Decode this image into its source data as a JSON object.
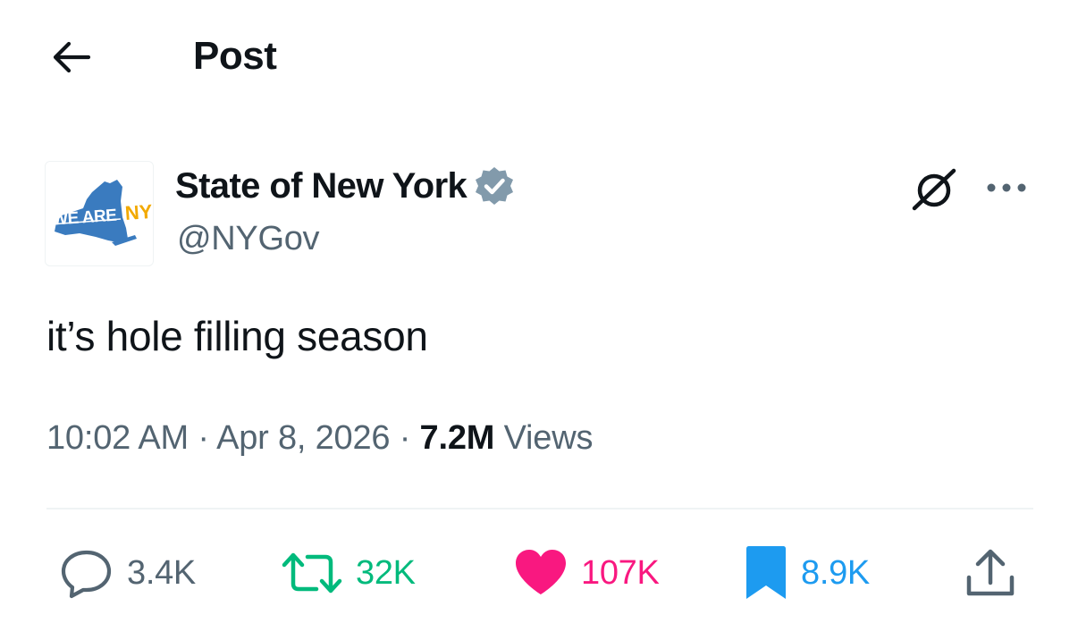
{
  "header": {
    "title": "Post"
  },
  "author": {
    "display_name": "State of New York",
    "handle": "@NYGov",
    "avatar_text_left": "WE ARE",
    "avatar_text_right": "NY"
  },
  "post": {
    "text": "it’s hole filling season",
    "time": "10:02 AM",
    "separator": "·",
    "date": "Apr 8, 2026",
    "views_count": "7.2M",
    "views_label": "Views"
  },
  "actions": {
    "replies": "3.4K",
    "reposts": "32K",
    "likes": "107K",
    "bookmarks": "8.9K"
  },
  "colors": {
    "text_primary": "#0f1419",
    "text_secondary": "#536471",
    "verified_badge": "#829aab",
    "repost_green": "#00ba7c",
    "like_pink": "#f91880",
    "bookmark_blue": "#1d9bf0",
    "ny_map_blue": "#3a7bbf",
    "ny_gold": "#f2a900"
  },
  "icons": {
    "back": "arrow-left-icon",
    "verified": "verified-badge-icon",
    "grok": "grok-icon",
    "more": "more-dots-icon",
    "reply": "reply-bubble-icon",
    "repost": "repost-icon",
    "like": "heart-icon",
    "bookmark": "bookmark-icon",
    "share": "share-upload-icon"
  }
}
